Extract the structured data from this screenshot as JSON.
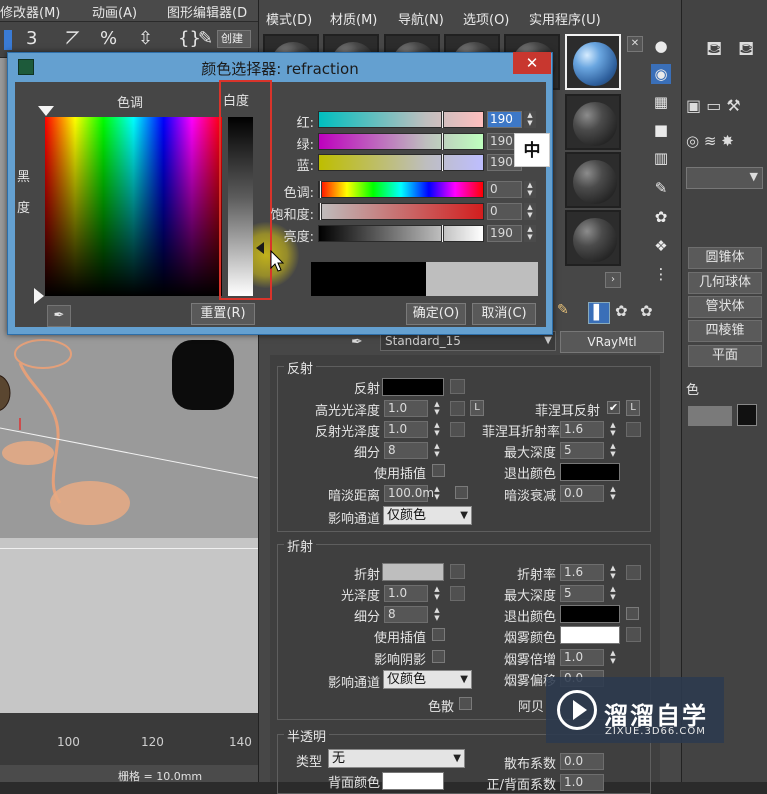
{
  "left_app": {
    "menu": [
      "修改器(M)",
      "动画(A)",
      "图形编辑器(D"
    ],
    "create_label": "创建",
    "ruler_numbers": [
      "100",
      "120",
      "140"
    ],
    "grid_label": "栅格 = 10.0mm"
  },
  "material_editor": {
    "menu": [
      "模式(D)",
      "材质(M)",
      "导航(N)",
      "选项(O)",
      "实用程序(U)"
    ],
    "material_name": "Standard_15",
    "material_type": "VRayMtl",
    "reflection": {
      "title": "反射",
      "reflect_label": "反射",
      "hilight_gloss_label": "高光光泽度",
      "hilight_gloss_value": "1.0",
      "refl_gloss_label": "反射光泽度",
      "refl_gloss_value": "1.0",
      "subdivs_label": "细分",
      "subdivs_value": "8",
      "use_interp_label": "使用插值",
      "dim_distance_label": "暗淡距离",
      "dim_distance_value": "100.0m",
      "affect_channels_label": "影响通道",
      "affect_channels_value": "仅颜色",
      "fresnel_label": "菲涅耳反射",
      "fresnel_checked": "✔",
      "l_label": "L",
      "fresnel_ior_label": "菲涅耳折射率",
      "fresnel_ior_value": "1.6",
      "max_depth_label": "最大深度",
      "max_depth_value": "5",
      "exit_color_label": "退出颜色",
      "dim_falloff_label": "暗淡衰减",
      "dim_falloff_value": "0.0"
    },
    "refraction": {
      "title": "折射",
      "refract_label": "折射",
      "gloss_label": "光泽度",
      "gloss_value": "1.0",
      "subdivs_label": "细分",
      "subdivs_value": "8",
      "use_interp_label": "使用插值",
      "affect_shadows_label": "影响阴影",
      "affect_channels_label": "影响通道",
      "affect_channels_value": "仅颜色",
      "dispersion_label": "色散",
      "ior_label": "折射率",
      "ior_value": "1.6",
      "max_depth_label": "最大深度",
      "max_depth_value": "5",
      "exit_color_label": "退出颜色",
      "fog_color_label": "烟雾颜色",
      "fog_mult_label": "烟雾倍增",
      "fog_mult_value": "1.0",
      "fog_bias_label": "烟雾偏移",
      "fog_bias_value": "0.0",
      "abbe_label": "阿贝"
    },
    "translucency": {
      "title": "半透明",
      "type_label": "类型",
      "type_value": "无",
      "back_color_label": "背面颜色",
      "scatter_label": "散布系数",
      "scatter_value": "0.0",
      "fwd_back_label": "正/背面系数",
      "fwd_back_value": "1.0"
    }
  },
  "right_panel": {
    "buttons": [
      "圆锥体",
      "几何球体",
      "管状体",
      "四棱锥",
      "平面"
    ],
    "color_label": "色"
  },
  "color_picker": {
    "title": "颜色选择器: refraction",
    "hue_label": "色调",
    "whiteness_label": "白度",
    "blackness_label_1": "黑",
    "blackness_label_2": "度",
    "channels": [
      {
        "label": "红:",
        "value": "190"
      },
      {
        "label": "绿:",
        "value": "190"
      },
      {
        "label": "蓝:",
        "value": "190"
      },
      {
        "label": "色调:",
        "value": "0"
      },
      {
        "label": "饱和度:",
        "value": "0"
      },
      {
        "label": "亮度:",
        "value": "190"
      }
    ],
    "ime_indicator": "中",
    "reset_label": "重置(R)",
    "ok_label": "确定(O)",
    "cancel_label": "取消(C)",
    "old_color": "#000000",
    "new_color": "#BEBEBE",
    "highlight_color": "#D9342B"
  },
  "watermark": {
    "name": "溜溜自学",
    "url": "ZIXUE.3D66.COM"
  }
}
